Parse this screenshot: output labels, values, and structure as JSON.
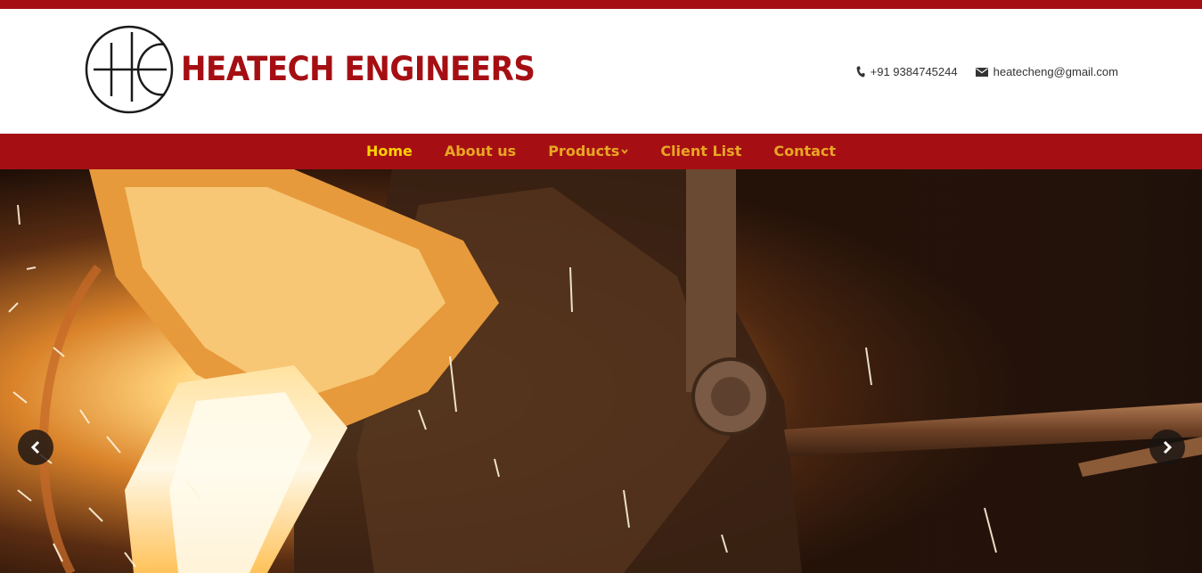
{
  "brand": {
    "name": "HEATECH ENGINEERS",
    "logo_icon": "he-monogram-icon"
  },
  "contact": {
    "phone": "+91 9384745244",
    "phone_icon": "phone-icon",
    "email": "heatecheng@gmail.com",
    "email_icon": "envelope-icon"
  },
  "nav": {
    "items": [
      {
        "label": "Home",
        "active": true
      },
      {
        "label": "About us",
        "active": false
      },
      {
        "label": "Products",
        "active": false,
        "has_dropdown": true
      },
      {
        "label": "Client List",
        "active": false
      },
      {
        "label": "Contact",
        "active": false
      }
    ]
  },
  "hero": {
    "prev_icon": "chevron-left-icon",
    "next_icon": "chevron-right-icon"
  },
  "colors": {
    "brand_red": "#a50f13",
    "nav_text": "#e9a623",
    "nav_active": "#ffd100"
  }
}
